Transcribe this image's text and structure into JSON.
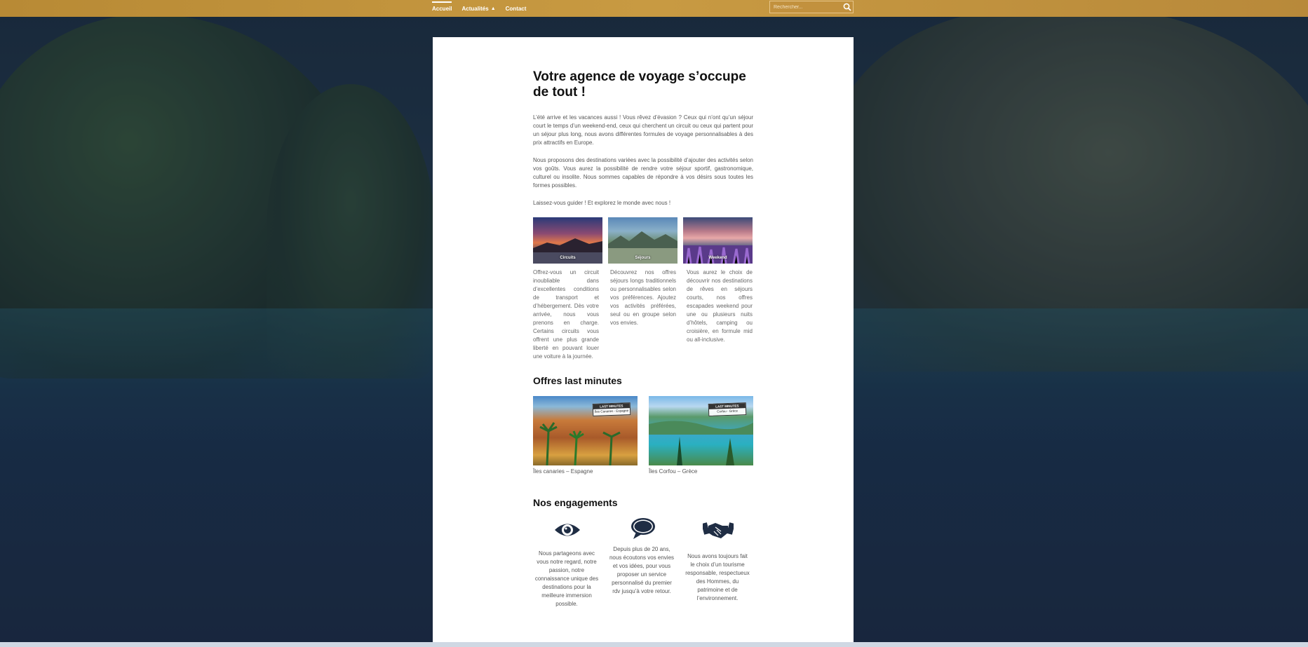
{
  "nav": {
    "items": [
      {
        "label": "Accueil",
        "active": true
      },
      {
        "label": "Actualités",
        "has_submenu": true
      },
      {
        "label": "Contact"
      }
    ]
  },
  "search": {
    "placeholder": "Rechercher..."
  },
  "main": {
    "title": "Votre agence de voyage s’occupe de tout !",
    "paragraphs": [
      "L’été arrive et les vacances aussi ! Vous rêvez d’évasion ? Ceux qui n’ont qu’un séjour court le temps d’un weekend-end, ceux qui cherchent un circuit ou ceux qui partent pour un séjour plus long, nous avons différentes formules de voyage personnalisables à des prix attractifs en Europe.",
      "Nous proposons des destinations variées avec la possibilité d’ajouter des activités selon vos goûts. Vous aurez la possibilité de rendre votre séjour sportif, gastronomique, culturel ou insolite. Nous sommes capables de répondre à vos désirs sous toutes les formes possibles.",
      "Laissez-vous guider ! Et explorez le monde avec nous !"
    ],
    "tiles": [
      {
        "label": "Circuits",
        "text": "Offrez-vous un circuit inoubliable dans d’excellentes conditions de transport et d’hébergement. Dès votre arrivée, nous vous prenons en charge. Certains circuits vous offrent une plus grande liberté en pouvant louer une voiture à la journée."
      },
      {
        "label": "Séjours",
        "text": "Découvrez nos offres séjours longs traditionnels ou personnalisables selon vos préférences. Ajoutez vos activités préférées, seul ou en groupe selon vos envies."
      },
      {
        "label": "Weekend",
        "text": "Vous aurez le choix de découvrir nos destinations de rêves en séjours courts, nos offres escapades weekend pour une ou plusieurs nuits d’hôtels, camping ou croisière, en formule mid ou all-inclusive."
      }
    ],
    "offers_title": "Offres last minutes",
    "offers": [
      {
        "badge": "LAST MINUTES",
        "badge_sub": "Îles Canaries - Espagne",
        "caption": "Îles canaries – Espagne"
      },
      {
        "badge": "LAST MINUTES",
        "badge_sub": "Corfou - Grèce",
        "caption": "Îles Corfou – Grèce"
      }
    ],
    "engagements_title": "Nos engagements",
    "engagements": [
      {
        "icon": "eye-icon",
        "text": "Nous partageons avec vous notre regard, notre passion, notre connaissance unique des destinations pour la meilleure immersion possible."
      },
      {
        "icon": "speech-bubble-icon",
        "text": "Depuis plus de 20 ans, nous écoutons vos envies et vos idées, pour vous proposer un service personnalisé du premier rdv jusqu’à votre retour."
      },
      {
        "icon": "handshake-icon",
        "text": "Nous avons toujours fait le choix d’un tourisme responsable, respectueux des Hommes, du patrimoine et de l’environnement."
      }
    ]
  },
  "colors": {
    "header": "#c8963e",
    "accent_dark": "#1f2d44",
    "card": "#ffffff"
  }
}
